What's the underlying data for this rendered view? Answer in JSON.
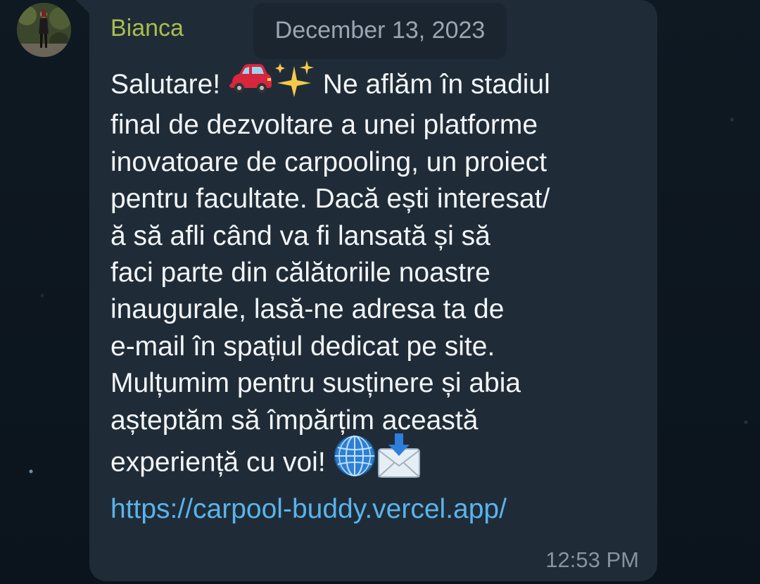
{
  "chat": {
    "date_label": "December 13, 2023",
    "message": {
      "sender": "Bianca",
      "time": "12:53 PM",
      "lines": [
        "Salutare!",
        "Ne aflăm în stadiul",
        "final de dezvoltare a unei platforme",
        "inovatoare de carpooling, un proiect",
        "pentru facultate. Dacă ești interesat/",
        "ă să afli când va fi lansată și să",
        "faci parte din călătoriile noastre",
        "inaugurale, lasă-ne adresa ta de",
        "e-mail în spațiul dedicat pe site.",
        "Mulțumim pentru susținere și abia",
        "așteptăm să împărțim această",
        "experiență cu voi!"
      ],
      "link": "https://carpool-buddy.vercel.app/",
      "emojis": [
        "red-car",
        "sparkles",
        "globe",
        "inbox-envelope"
      ]
    },
    "colors": {
      "background": "#0d1620",
      "bubble": "#1f2c38",
      "sender_name": "#a9bd4f",
      "link": "#5ab3ea",
      "text": "#f3f5f7",
      "muted": "#8793a0"
    }
  }
}
